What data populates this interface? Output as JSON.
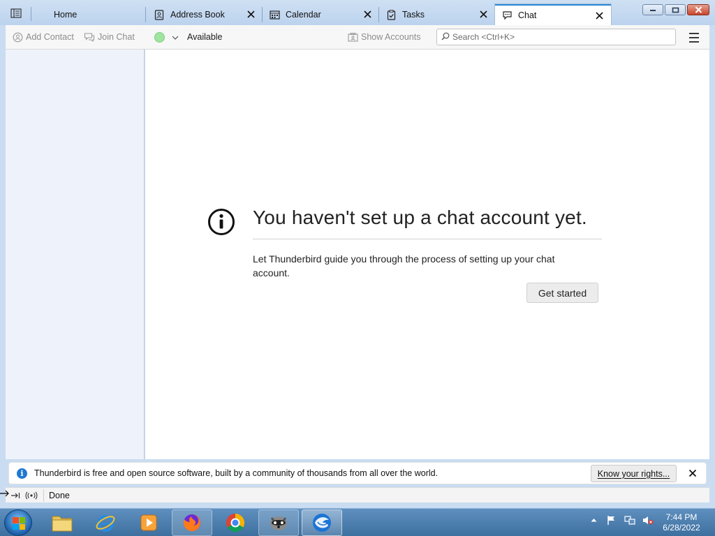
{
  "tabs": [
    {
      "label": "Home",
      "icon": "folder-icon"
    },
    {
      "label": "Address Book",
      "icon": "address-book-icon"
    },
    {
      "label": "Calendar",
      "icon": "calendar-icon"
    },
    {
      "label": "Tasks",
      "icon": "tasks-icon"
    },
    {
      "label": "Chat",
      "icon": "chat-icon",
      "active": true
    }
  ],
  "toolbar": {
    "add_contact": "Add Contact",
    "join_chat": "Join Chat",
    "status": "Available",
    "status_color": "#9fe49f",
    "show_accounts": "Show Accounts",
    "search_placeholder": "Search <Ctrl+K>"
  },
  "main": {
    "heading": "You haven't set up a chat account yet.",
    "description": "Let Thunderbird guide you through the process of setting up your chat account.",
    "get_started": "Get started"
  },
  "notification": {
    "text": "Thunderbird is free and open source software, built by a community of thousands from all over the world.",
    "button": "Know your rights..."
  },
  "statusbar": {
    "text": "Done"
  },
  "taskbar": {
    "time": "7:44 PM",
    "date": "6/28/2022"
  },
  "colors": {
    "accent": "#2a88d8",
    "info": "#1f78d1"
  }
}
